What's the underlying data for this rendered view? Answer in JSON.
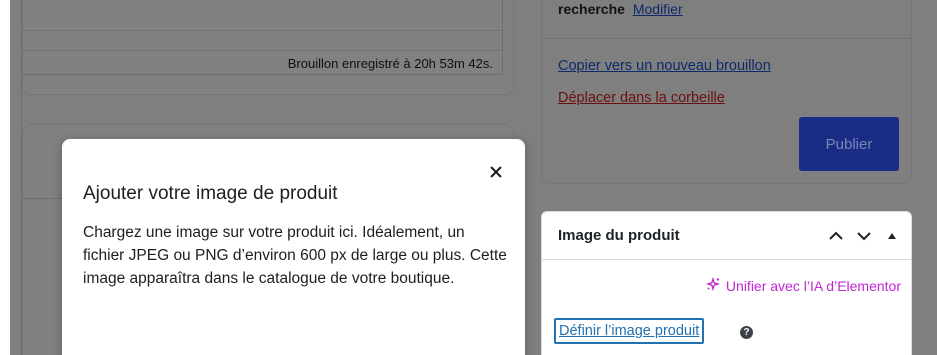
{
  "editor": {
    "status_text": "Brouillon enregistré à 20h 53m 42s."
  },
  "publish_box": {
    "search_label": "recherche",
    "modify_link": "Modifier",
    "copy_draft_link": "Copier vers un nouveau brouillon",
    "trash_link": "Déplacer dans la corbeille",
    "publish_button": "Publier"
  },
  "product_image_box": {
    "title": "Image du produit",
    "ai_link": "Unifier avec l’IA d’Elementor",
    "set_image_link": "Définir l’image produit",
    "help_icon": "question-circle-icon",
    "ai_color": "#c026d3"
  },
  "tour": {
    "title": "Ajouter votre image de produit",
    "body": "Chargez une image sur votre produit ici. Idéalement, un fichier JPEG ou PNG d’environ 600 px de large ou plus. Cette image apparaîtra dans le catalogue de votre boutique.",
    "close_icon": "close-icon"
  },
  "colors": {
    "overlay": "#7f7f7f",
    "publish_button": "#1a2c86",
    "link": "#2271b1"
  }
}
